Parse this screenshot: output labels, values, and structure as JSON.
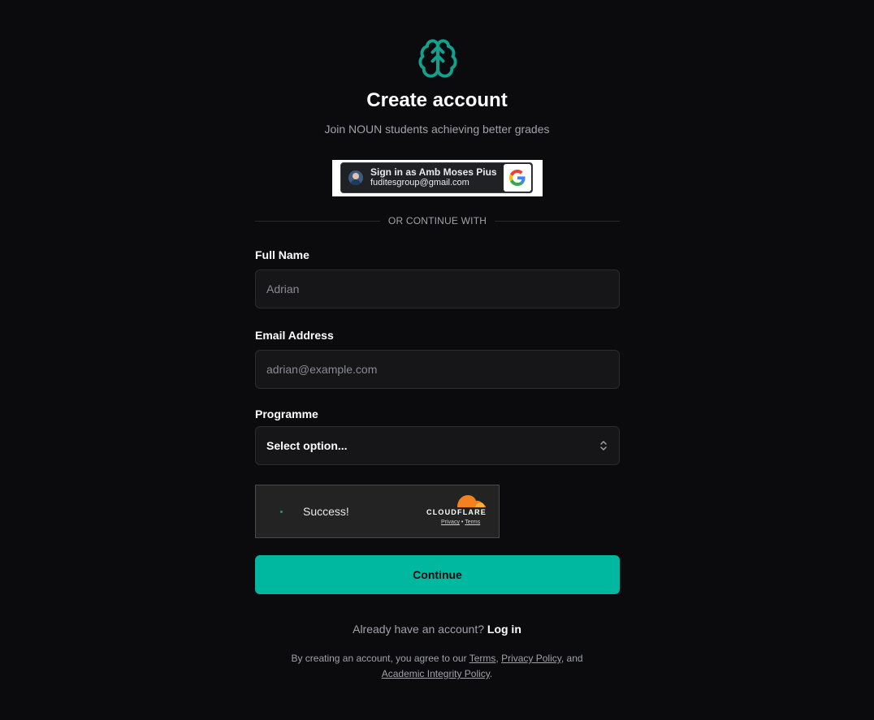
{
  "header": {
    "logo_icon": "brain-icon",
    "title": "Create account",
    "subtitle": "Join NOUN students achieving better grades"
  },
  "google_signin": {
    "line1": "Sign in as Amb Moses Pius",
    "line2": "fuditesgroup@gmail.com",
    "icon": "google-g-icon"
  },
  "divider": {
    "text": "OR CONTINUE WITH"
  },
  "form": {
    "full_name": {
      "label": "Full Name",
      "placeholder": "Adrian"
    },
    "email": {
      "label": "Email Address",
      "placeholder": "adrian@example.com"
    },
    "programme": {
      "label": "Programme",
      "value": "Select option...",
      "icon": "chevron-updown-icon"
    }
  },
  "captcha": {
    "status": "Success!",
    "brand": "CLOUDFLARE",
    "privacy": "Privacy",
    "separator": "•",
    "terms": "Terms"
  },
  "actions": {
    "continue": "Continue"
  },
  "footer": {
    "prompt": "Already have an account?",
    "login": "Log in",
    "legal_prefix": "By creating an account, you agree to our",
    "terms": "Terms",
    "comma": ",",
    "privacy": "Privacy Policy",
    "and": ", and",
    "integrity": "Academic Integrity Policy",
    "period": "."
  },
  "colors": {
    "background": "#0b0b0d",
    "accent": "#00b8a0",
    "logo": "#14a08c",
    "field_bg": "#161619",
    "cloudflare_orange": "#f48120"
  }
}
